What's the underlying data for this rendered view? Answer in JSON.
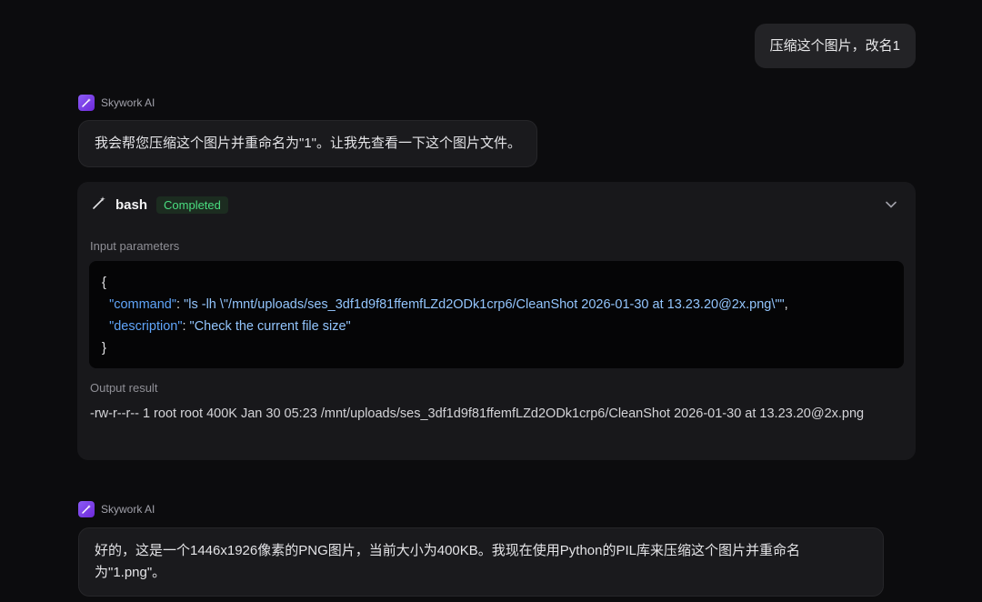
{
  "user_message": "压缩这个图片，改名1",
  "agent": {
    "name": "Skywork AI"
  },
  "messages": {
    "first": "我会帮您压缩这个图片并重命名为\"1\"。让我先查看一下这个图片文件。",
    "second": "好的，这是一个1446x1926像素的PNG图片，当前大小为400KB。我现在使用Python的PIL库来压缩这个图片并重命名为\"1.png\"。"
  },
  "tool": {
    "name": "bash",
    "status": "Completed",
    "input_label": "Input parameters",
    "output_label": "Output result",
    "params": {
      "open": "{",
      "command_key": "\"command\"",
      "command_value": "\"ls -lh \\\"/mnt/uploads/ses_3df1d9f81ffemfLZd2ODk1crp6/CleanShot 2026-01-30 at 13.23.20@2x.png\\\"\"",
      "description_key": "\"description\"",
      "description_value": "\"Check the current file size\"",
      "close": "}"
    },
    "output": "-rw-r--r-- 1 root root 400K Jan 30 05:23 /mnt/uploads/ses_3df1d9f81ffemfLZd2ODk1crp6/CleanShot 2026-01-30 at 13.23.20@2x.png"
  },
  "colors": {
    "accent": "#8b5cf6",
    "status": "#4ade80",
    "json_key": "#60a5fa"
  },
  "icons": {
    "agent": "magic-wand-icon",
    "tool": "wand-icon",
    "expand": "chevron-down-icon"
  }
}
